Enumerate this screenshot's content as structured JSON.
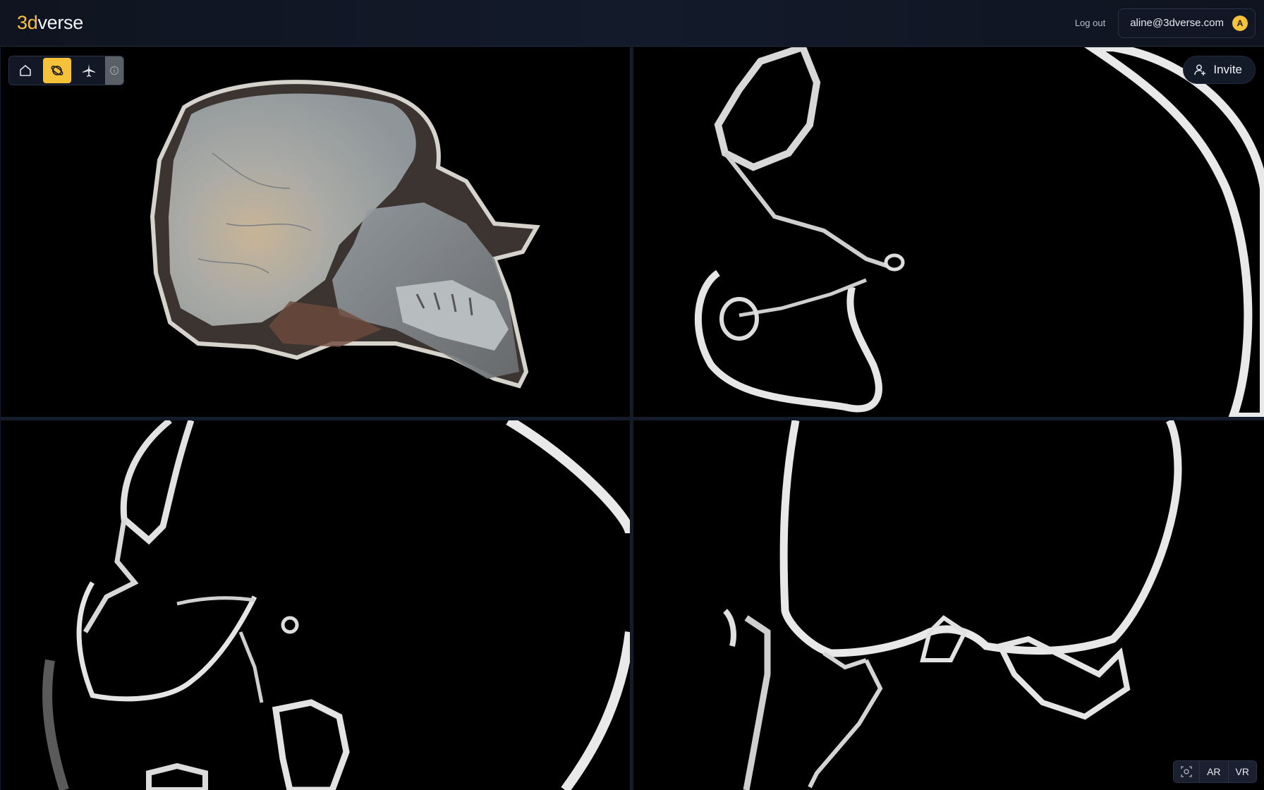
{
  "brand": {
    "prefix": "3d",
    "suffix": "verse",
    "accent_color": "#f5c23a"
  },
  "header": {
    "logout_label": "Log out",
    "account_email": "aline@3dverse.com",
    "avatar_initial": "A"
  },
  "toolbar": {
    "tools": [
      {
        "icon": "home-icon",
        "active": false
      },
      {
        "icon": "orbit-icon",
        "active": true
      },
      {
        "icon": "airplane-icon",
        "active": false
      },
      {
        "icon": "info-icon",
        "active": false,
        "disabled": true
      }
    ]
  },
  "invite": {
    "label": "Invite",
    "icon": "add-user-icon"
  },
  "viewports": [
    {
      "name": "3d-render",
      "content": "skull sagittal cut volume rendering"
    },
    {
      "name": "axial-slice",
      "content": "CT slice"
    },
    {
      "name": "sagittal-slice",
      "content": "CT slice"
    },
    {
      "name": "coronal-slice",
      "content": "CT slice"
    }
  ],
  "xr_controls": {
    "screenshot_icon": "screenshot-icon",
    "ar_label": "AR",
    "vr_label": "VR"
  }
}
